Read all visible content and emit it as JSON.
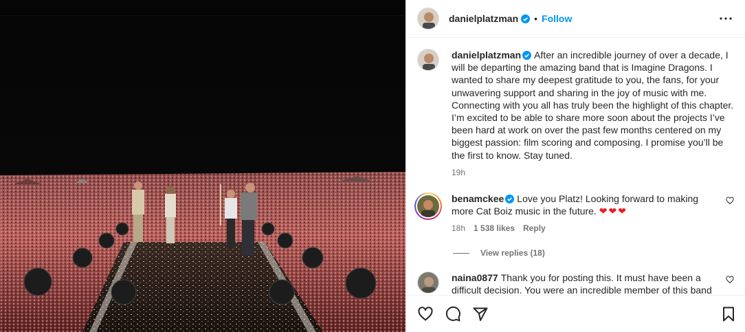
{
  "post": {
    "username": "danielplatzman",
    "follow_label": "Follow",
    "dot": "•"
  },
  "caption": {
    "username": "danielplatzman",
    "text": "After an incredible journey of over a decade, I will be departing the amazing band that is Imagine Dragons. I wanted to share my deepest gratitude to you, the fans, for your unwavering support and sharing in the joy of music with me. Connecting with you all has truly been the highlight of this chapter. I’m excited to be able to share more soon about the projects I’ve been hard at work on over the past few months centered on my biggest passion: film scoring and composing. I promise you’ll be the first to know. Stay tuned.",
    "time": "19h"
  },
  "comments": [
    {
      "username": "benamckee",
      "text": "Love you Platz! Looking forward to making more Cat Boiz music in the future.",
      "emoji": "❤❤❤",
      "time": "18h",
      "likes": "1 538 likes",
      "reply_label": "Reply",
      "view_replies": "View replies (18)"
    },
    {
      "username": "naina0877",
      "text": "Thank you for posting this. It must have been a difficult decision. You were an incredible member of this band"
    }
  ],
  "icons": {
    "more": "more-options-icon",
    "like": "heart-icon",
    "comment": "comment-icon",
    "share": "share-icon",
    "save": "bookmark-icon"
  },
  "colors": {
    "accent": "#0095f6",
    "verified": "#0095f6",
    "heart": "#ed1c24"
  }
}
